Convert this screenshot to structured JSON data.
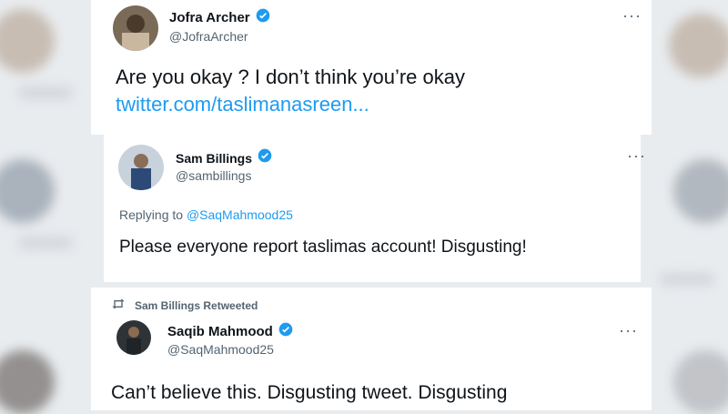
{
  "tweets": [
    {
      "name": "Jofra Archer",
      "handle": "@JofraArcher",
      "text": "Are you okay ? I don’t think you’re okay",
      "link": "twitter.com/taslimanasreen..."
    },
    {
      "name": "Sam Billings",
      "handle": "@sambillings",
      "replying_label": "Replying to",
      "replying_handle": "@SaqMahmood25",
      "text": "Please everyone report taslimas account! Disgusting!"
    },
    {
      "retweet_label": "Sam Billings Retweeted",
      "name": "Saqib Mahmood",
      "handle": "@SaqMahmood25",
      "text": "Can’t believe this. Disgusting tweet. Disgusting"
    }
  ],
  "icons": {
    "more": "more-icon",
    "verified": "verified-badge-icon",
    "retweet": "retweet-icon"
  },
  "colors": {
    "link": "#1d9bf0",
    "secondary_text": "#536471",
    "verified": "#1d9bf0"
  }
}
